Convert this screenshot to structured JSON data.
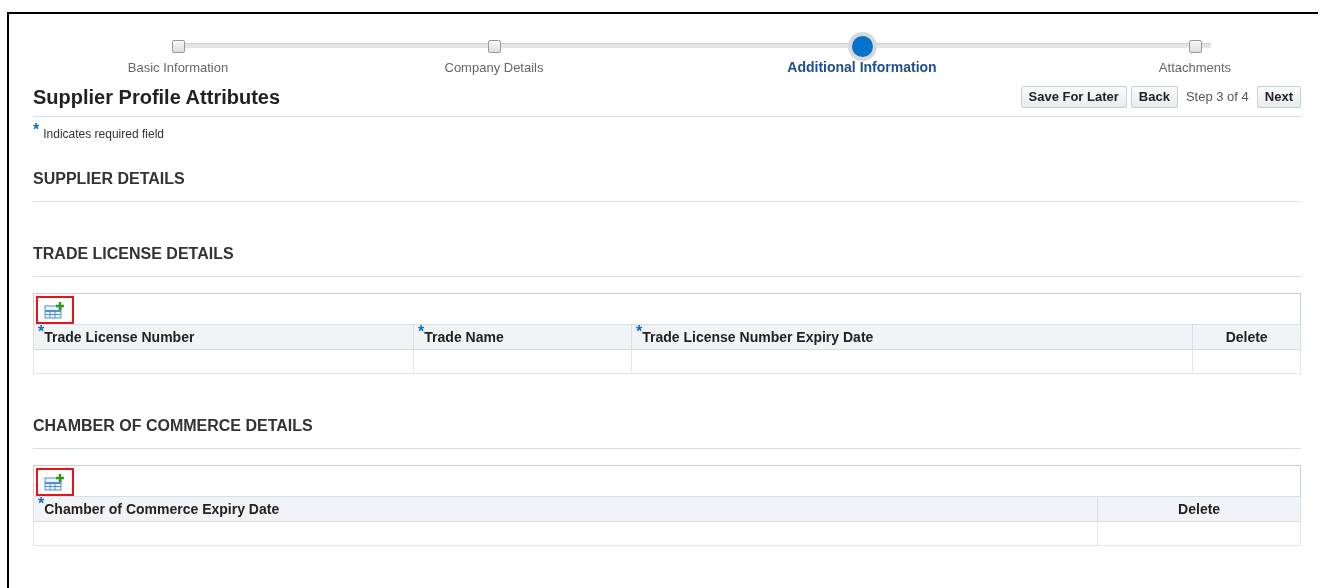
{
  "train": [
    {
      "label": "Basic Information",
      "selected": false
    },
    {
      "label": "Company Details",
      "selected": false
    },
    {
      "label": "Additional Information",
      "selected": true
    },
    {
      "label": "Attachments",
      "selected": false
    }
  ],
  "page_title": "Supplier Profile Attributes",
  "buttons": [
    {
      "kind": "button",
      "label": "Save For Later"
    },
    {
      "kind": "button",
      "label": "Back"
    },
    {
      "kind": "text",
      "label": "Step 3 of 4"
    },
    {
      "kind": "button",
      "label": "Next"
    }
  ],
  "required_note": {
    "mark": "*",
    "text": "Indicates required field"
  },
  "sections": [
    {
      "title": "SUPPLIER DETAILS"
    },
    {
      "title": "TRADE LICENSE DETAILS",
      "table": {
        "add_highlighted": true,
        "columns": [
          {
            "label": "Trade License Number",
            "required": true,
            "kind": "field"
          },
          {
            "label": "Trade Name",
            "required": true,
            "kind": "field"
          },
          {
            "label": "Trade License Number Expiry Date",
            "required": true,
            "kind": "field"
          },
          {
            "label": "Delete",
            "required": false,
            "kind": "action"
          }
        ]
      }
    },
    {
      "title": "CHAMBER OF COMMERCE DETAILS",
      "table": {
        "add_highlighted": true,
        "columns": [
          {
            "label": "Chamber of Commerce Expiry Date",
            "required": true,
            "kind": "field"
          },
          {
            "label": "Delete",
            "required": false,
            "kind": "action"
          }
        ]
      }
    }
  ]
}
